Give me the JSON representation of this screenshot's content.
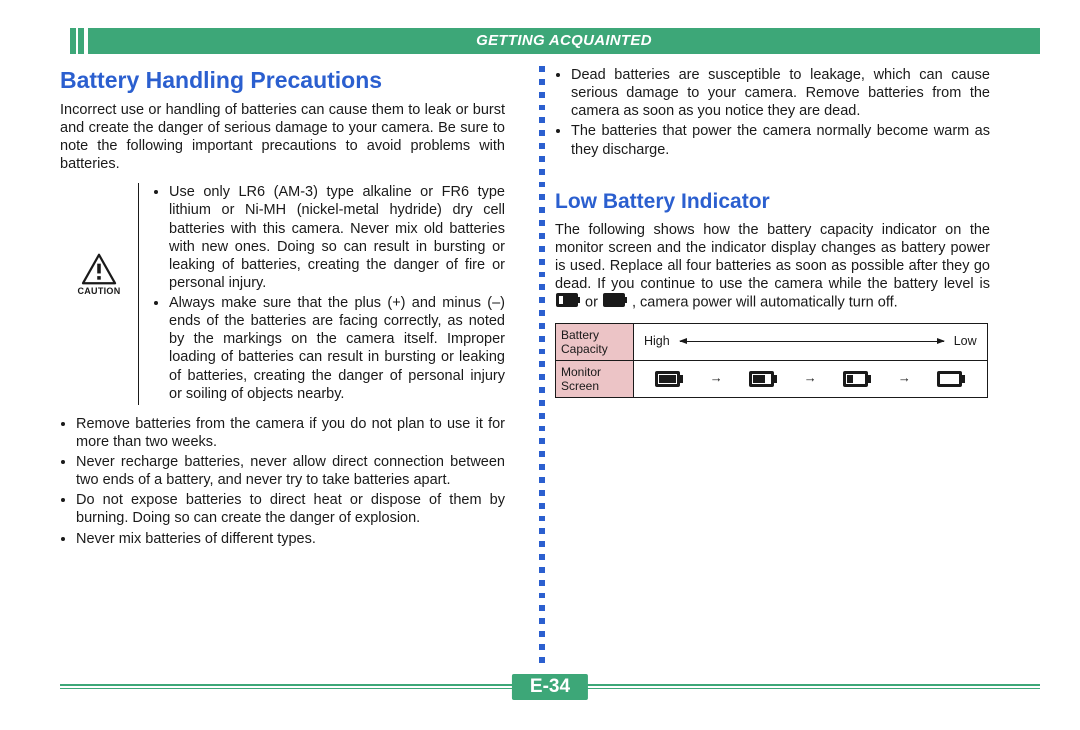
{
  "header": {
    "title": "GETTING ACQUAINTED"
  },
  "page_number": "E-34",
  "caution_label": "CAUTION",
  "left": {
    "h1": "Battery Handling Precautions",
    "intro": "Incorrect use or handling of batteries can cause them to leak or burst and create the danger of serious damage to your camera. Be sure to note the following important precautions to avoid problems with batteries.",
    "caution_items": [
      "Use only LR6 (AM-3) type alkaline or FR6 type lithium or Ni-MH (nickel-metal hydride) dry cell batteries with this camera. Never mix old batteries with new ones. Doing so can result in bursting or leaking of batteries, creating the danger of fire or personal injury.",
      "Always make sure that the plus (+) and minus (–) ends of the batteries are facing correctly, as noted by the markings on the camera itself. Improper loading of batteries can result in bursting or leaking of batteries, creating the danger of personal injury or soiling of objects nearby."
    ],
    "lower_items": [
      "Remove batteries from the camera if you do not plan to use it for more than two weeks.",
      "Never recharge batteries, never allow direct connection between two ends of a battery, and never try to take batteries apart.",
      "Do not expose batteries to direct heat or dispose of them by burning. Doing so can create the danger of explosion.",
      "Never mix batteries of different types."
    ]
  },
  "right": {
    "top_items": [
      "Dead batteries are susceptible to leakage, which can cause serious damage to your camera. Remove batteries from the camera as soon as you notice they are dead.",
      "The batteries that power the camera normally become warm as they discharge."
    ],
    "h1": "Low Battery Indicator",
    "intro_a": "The following shows how the battery capacity indicator on the monitor screen and the indicator display changes as battery power is used. Replace all four batteries as soon as possible after they go dead. If you continue to use the camera while the battery level is ",
    "intro_b": " or ",
    "intro_c": ", camera power will automatically turn off.",
    "table": {
      "row1_label": "Battery Capacity",
      "row2_label": "Monitor Screen",
      "high": "High",
      "low": "Low"
    }
  }
}
